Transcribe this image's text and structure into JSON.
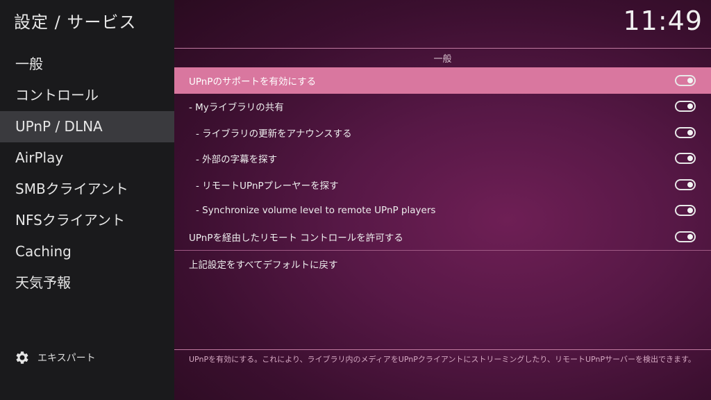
{
  "header": {
    "title": "設定 / サービス"
  },
  "clock": "11:49",
  "sidebar": {
    "items": [
      {
        "label": "一般"
      },
      {
        "label": "コントロール"
      },
      {
        "label": "UPnP / DLNA"
      },
      {
        "label": "AirPlay"
      },
      {
        "label": "SMBクライアント"
      },
      {
        "label": "NFSクライアント"
      },
      {
        "label": "Caching"
      },
      {
        "label": "天気予報"
      }
    ],
    "active_index": 2,
    "expert_label": "エキスパート",
    "expert_icon": "gear-icon"
  },
  "section": {
    "title": "一般"
  },
  "settings": [
    {
      "label": "UPnPのサポートを有効にする",
      "enabled": true
    },
    {
      "label": "- Myライブラリの共有",
      "enabled": true
    },
    {
      "label": "  - ライブラリの更新をアナウンスする",
      "enabled": true
    },
    {
      "label": "  - 外部の字幕を探す",
      "enabled": true
    },
    {
      "label": "  - リモートUPnPプレーヤーを探す",
      "enabled": true
    },
    {
      "label": "  - Synchronize volume level to remote UPnP players",
      "enabled": true
    },
    {
      "label": "UPnPを経由したリモート コントロールを許可する",
      "enabled": true
    }
  ],
  "reset_label": "上記設定をすべてデフォルトに戻す",
  "footer": {
    "description": "UPnPを有効にする。これにより、ライブラリ内のメディアをUPnPクライアントにストリーミングしたり、リモートUPnPサーバーを検出できます。"
  },
  "colors": {
    "accent": "#d9779f",
    "sidebar_bg": "#1a1a1c",
    "active_bg": "#3a3a3e"
  }
}
